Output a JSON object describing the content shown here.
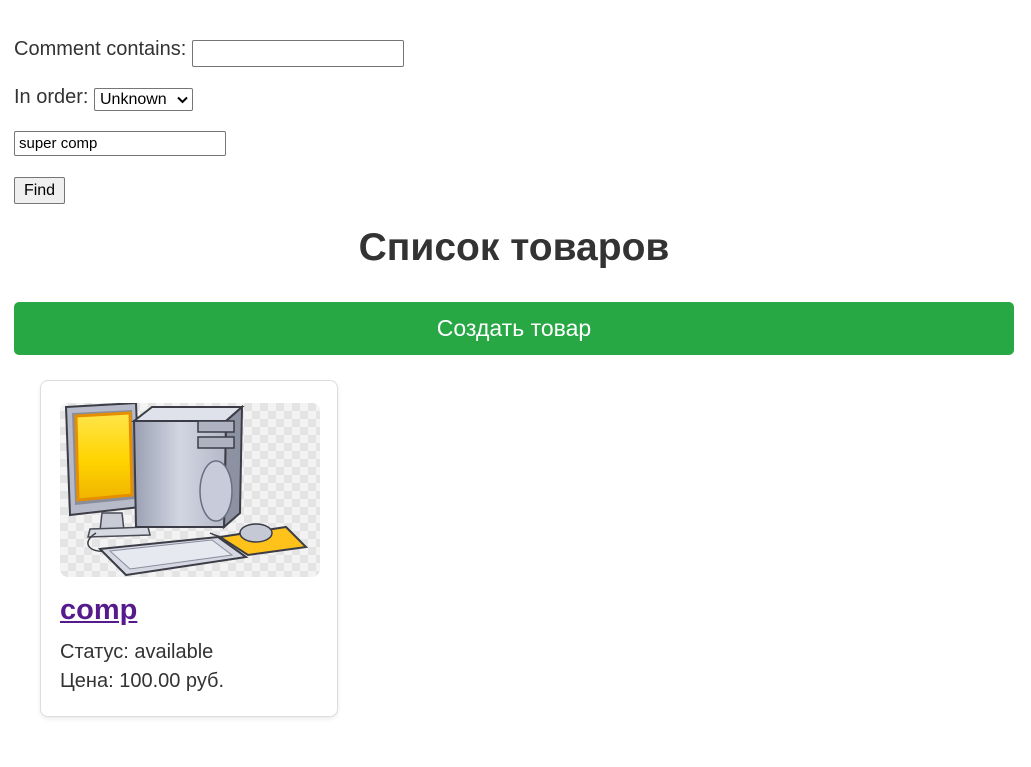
{
  "filters": {
    "comment_label": "Comment contains:",
    "comment_value": "",
    "order_label": "In order:",
    "order_selected": "Unknown",
    "query_value": "super comp",
    "find_label": "Find"
  },
  "header": {
    "title": "Список товаров"
  },
  "create_button": {
    "label": "Создать товар"
  },
  "products": [
    {
      "name": "comp",
      "status_line": "Статус: available",
      "price_line": "Цена: 100.00 руб.",
      "image_icon": "desktop-computer-icon"
    }
  ],
  "colors": {
    "create_button": "#28a745",
    "product_link": "#551a8b",
    "text": "#333333"
  }
}
